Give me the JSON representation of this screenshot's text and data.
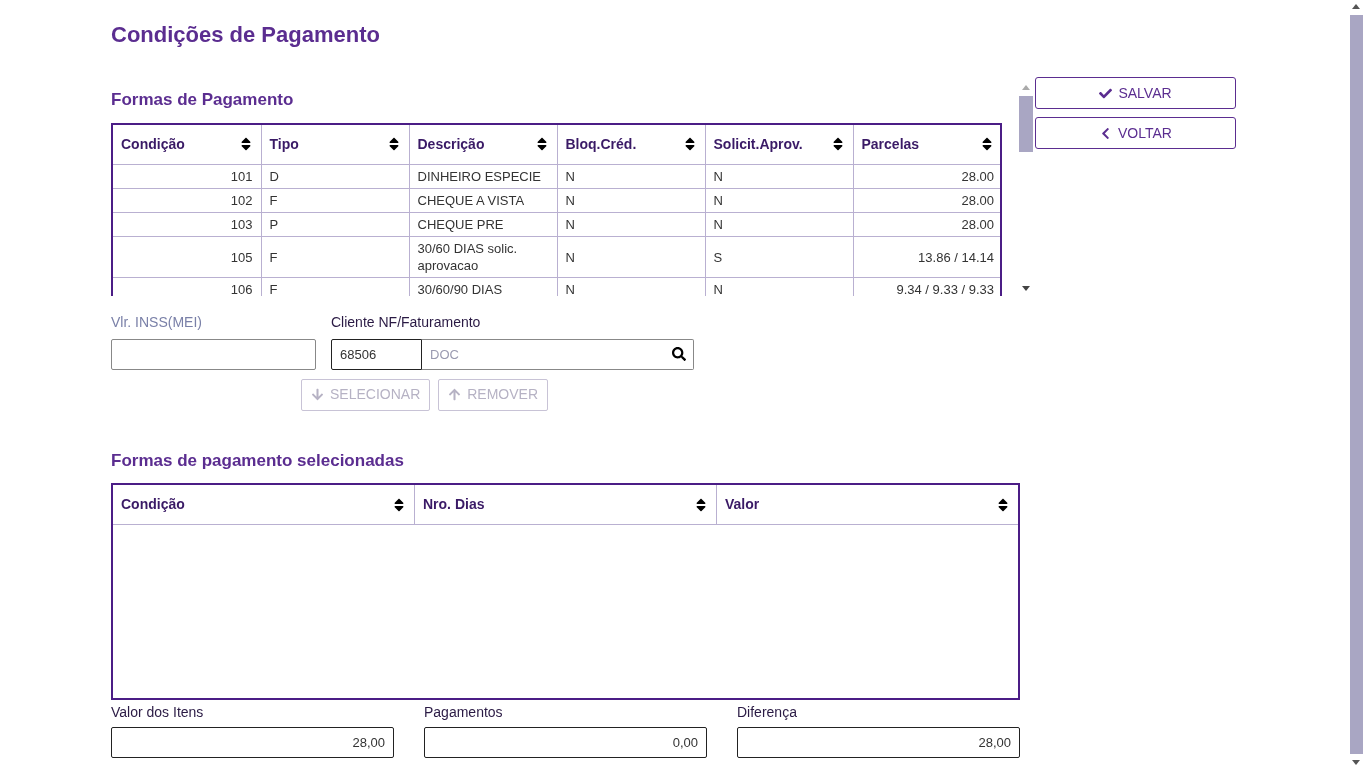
{
  "page_title": "Condições de Pagamento",
  "actions": [
    {
      "kind": "save",
      "label": "SALVAR"
    },
    {
      "kind": "back",
      "label": "VOLTAR"
    }
  ],
  "payment_methods": {
    "title": "Formas de Pagamento",
    "columns": [
      "Condição",
      "Tipo",
      "Descrição",
      "Bloq.Créd.",
      "Solicit.Aprov.",
      "Parcelas"
    ],
    "rows": [
      [
        "101",
        "D",
        "DINHEIRO ESPECIE",
        "N",
        "N",
        "28.00"
      ],
      [
        "102",
        "F",
        "CHEQUE A VISTA",
        "N",
        "N",
        "28.00"
      ],
      [
        "103",
        "P",
        "CHEQUE PRE",
        "N",
        "N",
        "28.00"
      ],
      [
        "105",
        "F",
        "30/60 DIAS solic. aprovacao",
        "N",
        "S",
        "13.86 / 14.14"
      ],
      [
        "106",
        "F",
        "30/60/90 DIAS",
        "N",
        "N",
        "9.34 / 9.33 / 9.33"
      ]
    ]
  },
  "inss_field": {
    "label": "Vlr. INSS(MEI)"
  },
  "client_field": {
    "label": "Cliente NF/Faturamento",
    "value": "68506",
    "placeholder": "DOC"
  },
  "move_buttons": [
    {
      "kind": "down",
      "label": "SELECIONAR",
      "disabled": true
    },
    {
      "kind": "up",
      "label": "REMOVER",
      "disabled": true
    }
  ],
  "selected_methods": {
    "title": "Formas de pagamento selecionadas",
    "columns": [
      "Condição",
      "Nro. Dias",
      "Valor"
    ]
  },
  "totals": [
    {
      "label": "Valor dos Itens",
      "value": "28,00"
    },
    {
      "label": "Pagamentos",
      "value": "0,00"
    },
    {
      "label": "Diferença",
      "value": "28,00"
    }
  ]
}
